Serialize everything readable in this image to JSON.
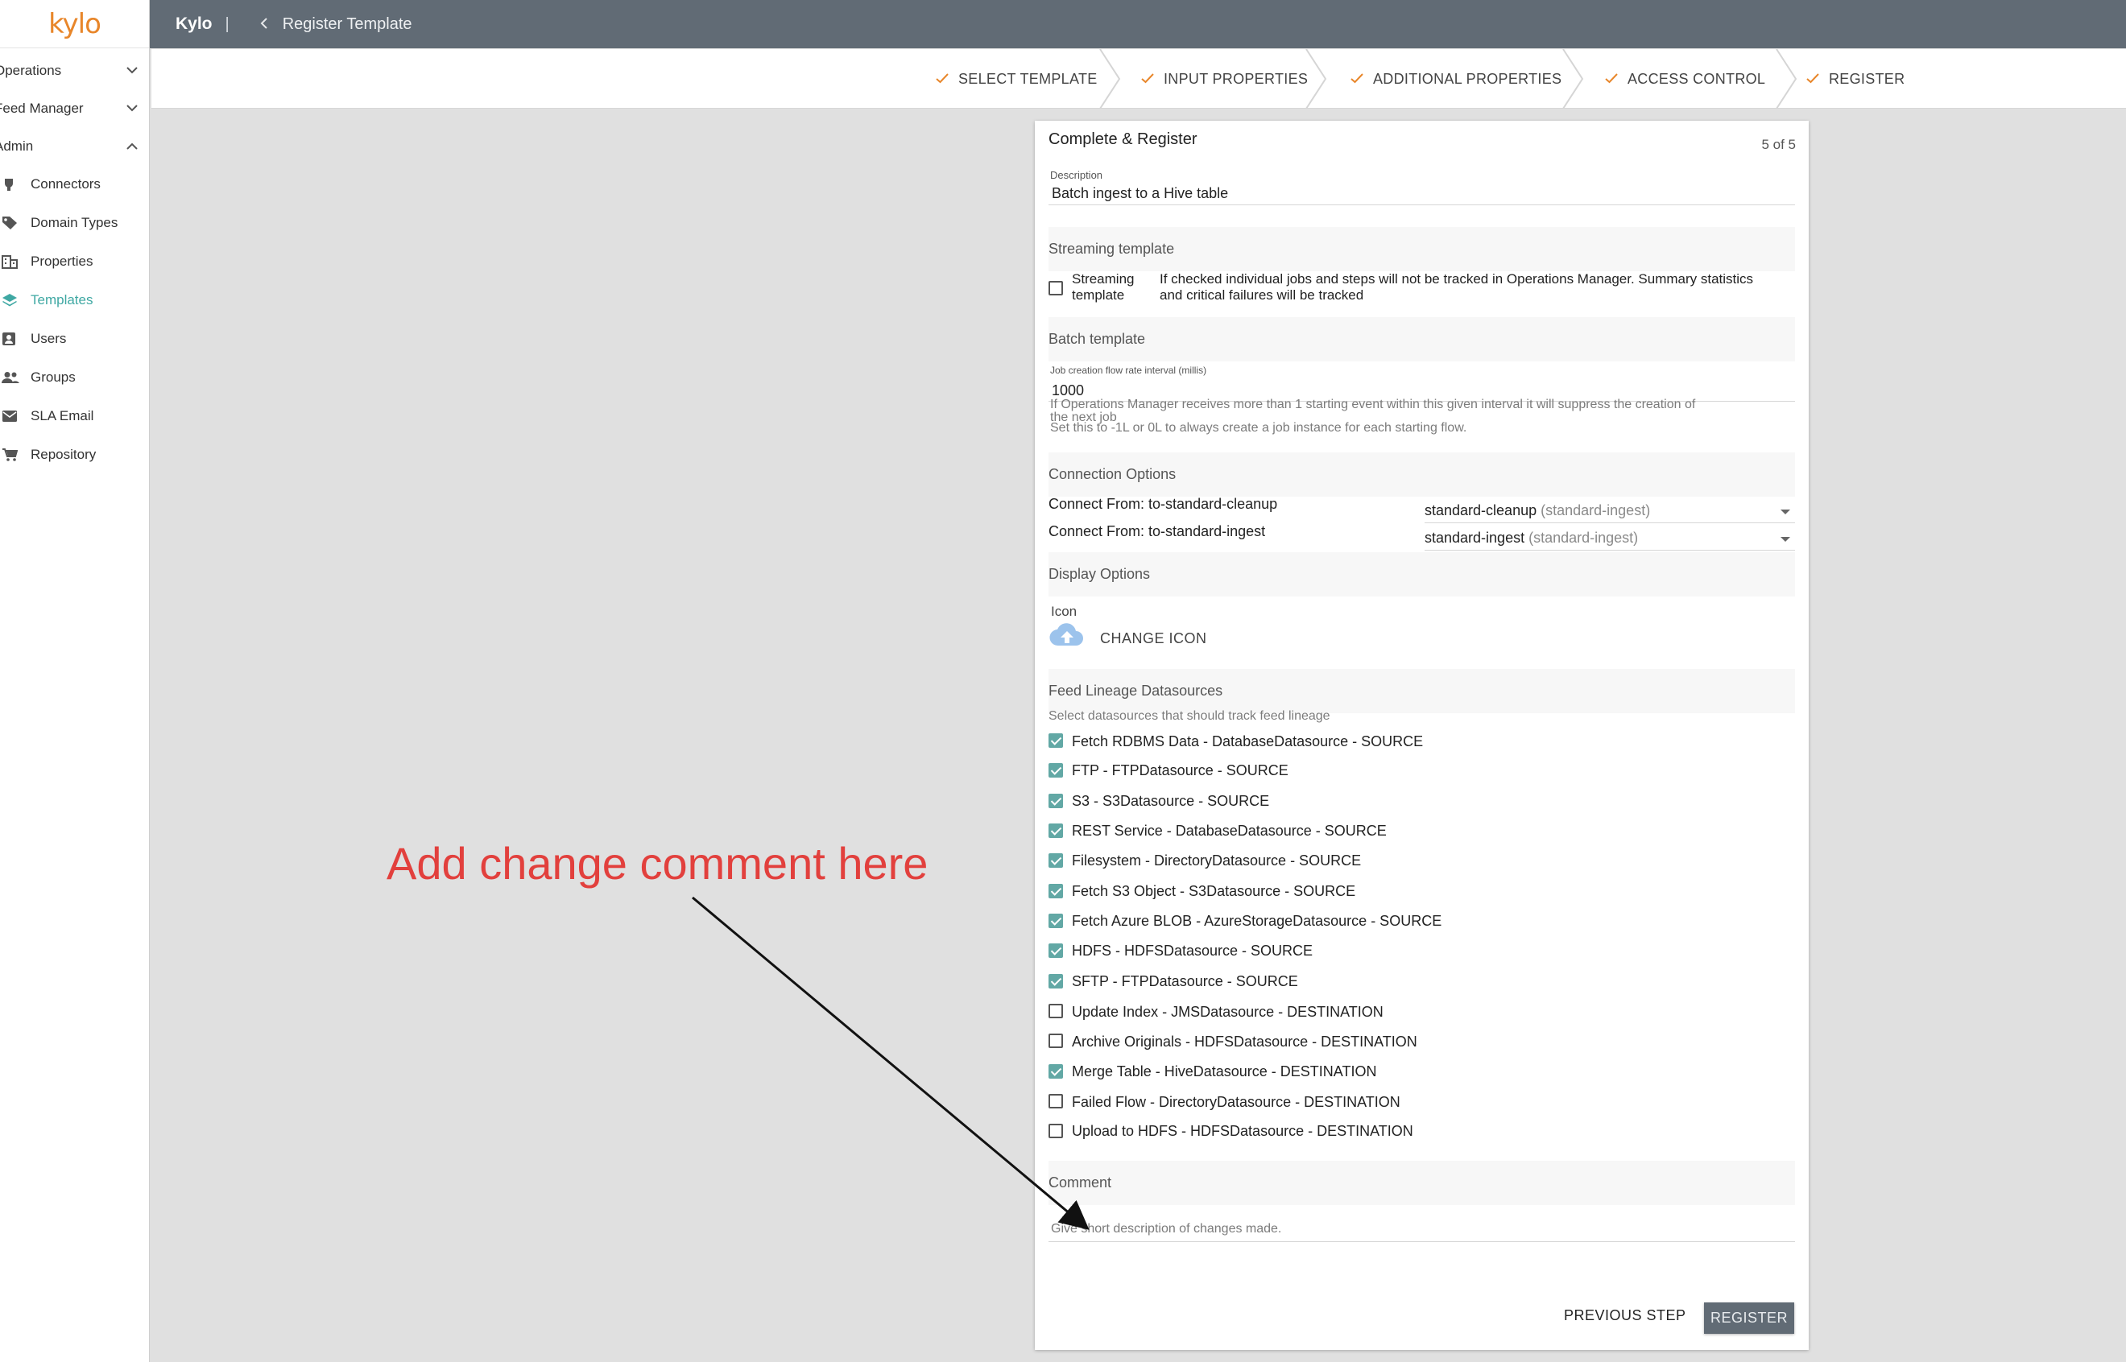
{
  "logo": "kylo",
  "sidebar": {
    "groups": [
      {
        "label": "Operations"
      },
      {
        "label": "Feed Manager"
      },
      {
        "label": "Admin"
      }
    ],
    "items": [
      {
        "label": "Connectors",
        "icon": "plug-icon"
      },
      {
        "label": "Domain Types",
        "icon": "tag-icon"
      },
      {
        "label": "Properties",
        "icon": "building-icon"
      },
      {
        "label": "Templates",
        "icon": "layers-icon",
        "active": true
      },
      {
        "label": "Users",
        "icon": "user-icon"
      },
      {
        "label": "Groups",
        "icon": "group-icon"
      },
      {
        "label": "SLA Email",
        "icon": "mail-icon"
      },
      {
        "label": "Repository",
        "icon": "cart-icon"
      }
    ]
  },
  "topbar": {
    "app_name": "Kylo",
    "separator": "|",
    "page_title": "Register Template"
  },
  "stepper": {
    "steps": [
      {
        "label": "SELECT TEMPLATE"
      },
      {
        "label": "INPUT PROPERTIES"
      },
      {
        "label": "ADDITIONAL PROPERTIES"
      },
      {
        "label": "ACCESS CONTROL"
      },
      {
        "label": "REGISTER"
      }
    ]
  },
  "card": {
    "title": "Complete & Register",
    "step_count": "5 of 5",
    "description": {
      "label": "Description",
      "value": "Batch ingest to a Hive table"
    },
    "streaming": {
      "header": "Streaming template",
      "checkbox_label_1": "Streaming",
      "checkbox_label_2": "template",
      "help_1": "If checked individual jobs and steps will not be tracked in Operations Manager. Summary statistics",
      "help_2": "and critical failures will be tracked"
    },
    "batch": {
      "header": "Batch template",
      "field_label": "Job creation flow rate interval (millis)",
      "field_value": "1000",
      "hint_1": "If Operations Manager receives more than 1 starting event within this given interval it will suppress the creation of",
      "hint_2": "the next job",
      "hint_3": "Set this to -1L or 0L to always create a job instance for each starting flow."
    },
    "connection": {
      "header": "Connection Options",
      "rows": [
        {
          "label": "Connect From: to-standard-cleanup",
          "value": "standard-cleanup",
          "sub": "(standard-ingest)"
        },
        {
          "label": "Connect From: to-standard-ingest",
          "value": "standard-ingest",
          "sub": "(standard-ingest)"
        }
      ]
    },
    "display": {
      "header": "Display Options",
      "icon_label": "Icon",
      "change_icon": "CHANGE ICON"
    },
    "lineage": {
      "header": "Feed Lineage Datasources",
      "hint": "Select datasources that should track feed lineage",
      "items": [
        {
          "label": "Fetch RDBMS Data - DatabaseDatasource - SOURCE",
          "checked": true
        },
        {
          "label": "FTP - FTPDatasource - SOURCE",
          "checked": true
        },
        {
          "label": "S3 - S3Datasource - SOURCE",
          "checked": true
        },
        {
          "label": "REST Service - DatabaseDatasource - SOURCE",
          "checked": true
        },
        {
          "label": "Filesystem - DirectoryDatasource - SOURCE",
          "checked": true
        },
        {
          "label": "Fetch S3 Object - S3Datasource - SOURCE",
          "checked": true
        },
        {
          "label": "Fetch Azure BLOB - AzureStorageDatasource - SOURCE",
          "checked": true
        },
        {
          "label": "HDFS - HDFSDatasource - SOURCE",
          "checked": true
        },
        {
          "label": "SFTP - FTPDatasource - SOURCE",
          "checked": true
        },
        {
          "label": "Update Index - JMSDatasource - DESTINATION",
          "checked": false
        },
        {
          "label": "Archive Originals - HDFSDatasource - DESTINATION",
          "checked": false
        },
        {
          "label": "Merge Table - HiveDatasource - DESTINATION",
          "checked": true
        },
        {
          "label": "Failed Flow - DirectoryDatasource - DESTINATION",
          "checked": false
        },
        {
          "label": "Upload to HDFS - HDFSDatasource - DESTINATION",
          "checked": false
        }
      ]
    },
    "comment": {
      "header": "Comment",
      "placeholder": "Give short description of changes made."
    },
    "buttons": {
      "previous": "PREVIOUS STEP",
      "register": "REGISTER"
    }
  },
  "annotation": {
    "text": "Add change comment here",
    "color": "#e2403d"
  },
  "colors": {
    "accent": "#e8862a",
    "active": "#3fa8a3",
    "checkbox": "#62a8a5",
    "topbar": "#616b75"
  }
}
